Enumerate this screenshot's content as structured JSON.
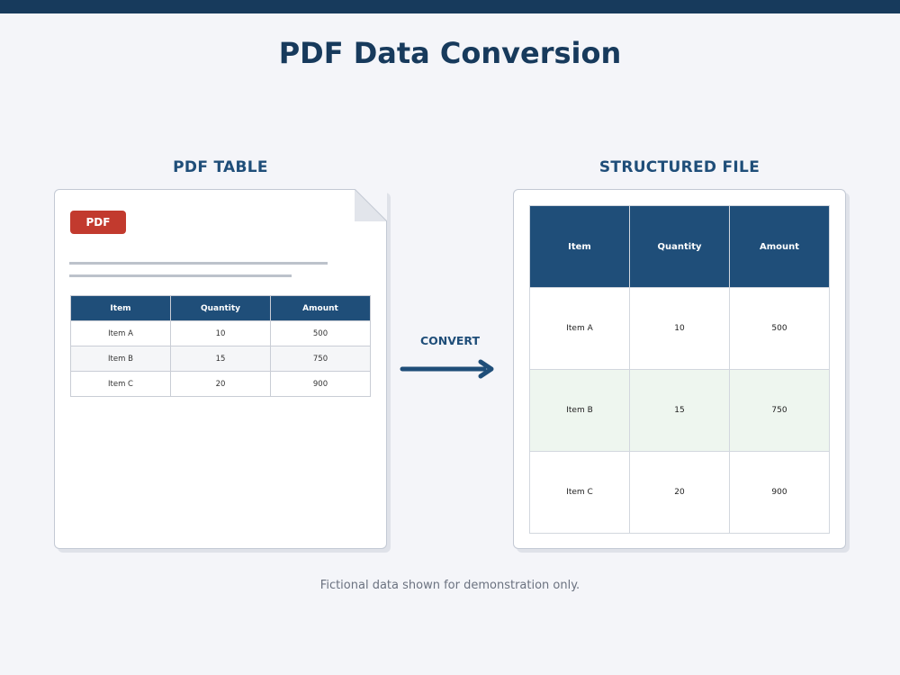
{
  "title": "PDF Data Conversion",
  "left_panel": {
    "label": "PDF TABLE",
    "badge": "PDF",
    "table": {
      "headers": [
        "Item",
        "Quantity",
        "Amount"
      ],
      "rows": [
        [
          "Item A",
          "10",
          "500"
        ],
        [
          "Item B",
          "15",
          "750"
        ],
        [
          "Item C",
          "20",
          "900"
        ]
      ]
    }
  },
  "arrow": {
    "label": "CONVERT"
  },
  "right_panel": {
    "label": "STRUCTURED FILE",
    "table": {
      "headers": [
        "Item",
        "Quantity",
        "Amount"
      ],
      "rows": [
        [
          "Item A",
          "10",
          "500"
        ],
        [
          "Item B",
          "15",
          "750"
        ],
        [
          "Item C",
          "20",
          "900"
        ]
      ]
    }
  },
  "footnote": "Fictional data shown for demonstration only.",
  "colors": {
    "header_blue": "#1f4e79",
    "top_bar": "#173a5c",
    "pdf_badge": "#c23a2e",
    "highlight_row": "#eef6ef"
  }
}
